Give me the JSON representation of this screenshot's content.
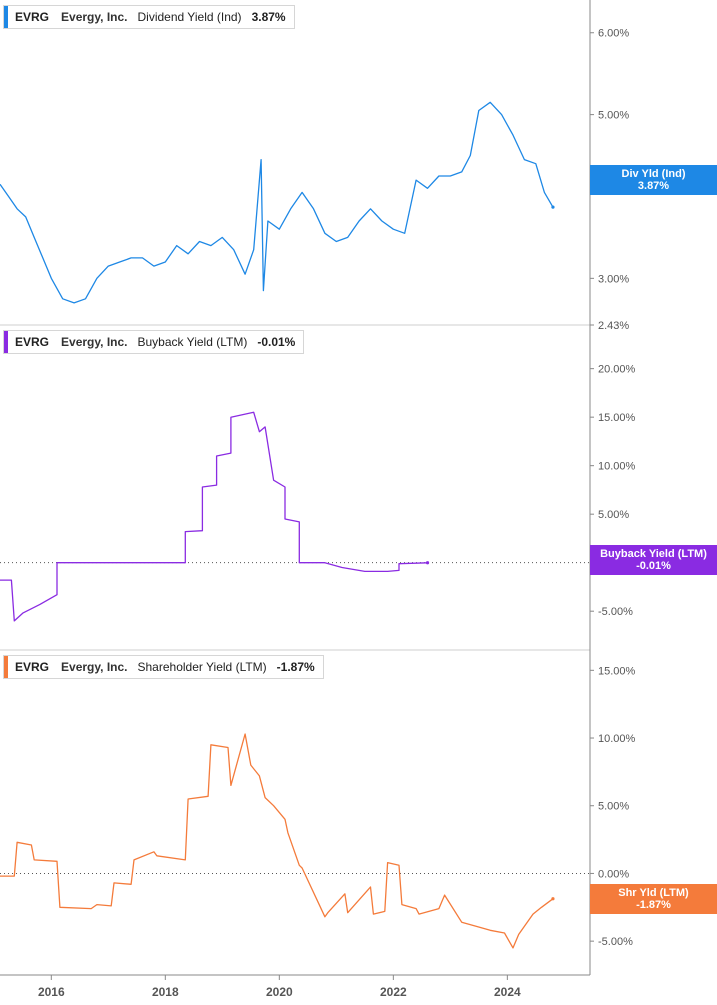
{
  "x_axis": {
    "ticks": [
      "2016",
      "2018",
      "2020",
      "2022",
      "2024"
    ]
  },
  "panels": [
    {
      "ticker": "EVRG",
      "company": "Evergy, Inc.",
      "metric": "Dividend Yield (Ind)",
      "value": "3.87%",
      "color": "#1e88e5",
      "y_ticks": [
        "6.00%",
        "5.00%",
        "3.00%",
        "2.43%"
      ],
      "callout_label": "Div Yld (Ind)",
      "callout_value": "3.87%"
    },
    {
      "ticker": "EVRG",
      "company": "Evergy, Inc.",
      "metric": "Buyback Yield (LTM)",
      "value": "-0.01%",
      "color": "#8a2be2",
      "y_ticks": [
        "20.00%",
        "15.00%",
        "10.00%",
        "5.00%",
        "-5.00%"
      ],
      "callout_label": "Buyback Yield (LTM)",
      "callout_value": "-0.01%"
    },
    {
      "ticker": "EVRG",
      "company": "Evergy, Inc.",
      "metric": "Shareholder Yield (LTM)",
      "value": "-1.87%",
      "color": "#f47b3b",
      "y_ticks": [
        "15.00%",
        "10.00%",
        "5.00%",
        "0.00%",
        "-5.00%"
      ],
      "callout_label": "Shr Yld (LTM)",
      "callout_value": "-1.87%"
    }
  ],
  "chart_data": [
    {
      "type": "line",
      "title": "EVRG Evergy, Inc. Dividend Yield (Ind)",
      "color": "#1e88e5",
      "y_ticks": [
        6.0,
        5.0,
        3.0,
        2.43
      ],
      "ylim": [
        2.43,
        6.4
      ],
      "x": [
        2015.6,
        2015.75,
        2015.9,
        2016.05,
        2016.2,
        2016.35,
        2016.5,
        2016.7,
        2016.9,
        2017.1,
        2017.3,
        2017.5,
        2017.7,
        2017.9,
        2018.1,
        2018.3,
        2018.5,
        2018.7,
        2018.9,
        2019.1,
        2019.3,
        2019.5,
        2019.7,
        2019.9,
        2020.05,
        2020.18,
        2020.22,
        2020.3,
        2020.5,
        2020.7,
        2020.9,
        2021.1,
        2021.3,
        2021.5,
        2021.7,
        2021.9,
        2022.1,
        2022.3,
        2022.5,
        2022.7,
        2022.9,
        2023.1,
        2023.3,
        2023.5,
        2023.7,
        2023.85,
        2024.0,
        2024.2,
        2024.4,
        2024.6,
        2024.8,
        2025.0,
        2025.15,
        2025.3
      ],
      "values": [
        4.15,
        4.0,
        3.85,
        3.75,
        3.5,
        3.25,
        3.0,
        2.75,
        2.7,
        2.75,
        3.0,
        3.15,
        3.2,
        3.25,
        3.25,
        3.15,
        3.2,
        3.4,
        3.3,
        3.45,
        3.4,
        3.5,
        3.35,
        3.05,
        3.35,
        4.45,
        2.85,
        3.7,
        3.6,
        3.85,
        4.05,
        3.85,
        3.55,
        3.45,
        3.5,
        3.7,
        3.85,
        3.7,
        3.6,
        3.55,
        4.2,
        4.1,
        4.25,
        4.25,
        4.3,
        4.5,
        5.05,
        5.15,
        5.0,
        4.75,
        4.45,
        4.4,
        4.05,
        3.87
      ]
    },
    {
      "type": "line",
      "title": "EVRG Evergy, Inc. Buyback Yield (LTM)",
      "color": "#8a2be2",
      "y_ticks": [
        20.0,
        15.0,
        10.0,
        5.0,
        -5.0
      ],
      "ylim": [
        -9,
        24.5
      ],
      "x": [
        2015.6,
        2015.8,
        2015.85,
        2016.0,
        2016.3,
        2016.6,
        2016.6,
        2018.85,
        2018.85,
        2019.15,
        2019.15,
        2019.4,
        2019.4,
        2019.65,
        2019.65,
        2020.05,
        2020.15,
        2020.25,
        2020.4,
        2020.6,
        2020.6,
        2020.85,
        2020.85,
        2021.3,
        2021.6,
        2022.0,
        2022.4,
        2022.6,
        2022.6,
        2023.1
      ],
      "values": [
        -1.8,
        -1.8,
        -6.0,
        -5.2,
        -4.3,
        -3.3,
        0.0,
        0.0,
        3.2,
        3.3,
        7.8,
        8.0,
        11.0,
        11.3,
        15.0,
        15.5,
        13.5,
        14.0,
        8.5,
        7.8,
        4.5,
        4.2,
        0.0,
        0.0,
        -0.5,
        -0.9,
        -0.9,
        -0.8,
        -0.1,
        -0.01
      ]
    },
    {
      "type": "line",
      "title": "EVRG Evergy, Inc. Shareholder Yield (LTM)",
      "color": "#f47b3b",
      "y_ticks": [
        15.0,
        10.0,
        5.0,
        0.0,
        -5.0
      ],
      "ylim": [
        -7.5,
        16.5
      ],
      "x": [
        2015.6,
        2015.85,
        2015.9,
        2016.15,
        2016.2,
        2016.6,
        2016.65,
        2017.2,
        2017.3,
        2017.55,
        2017.6,
        2017.9,
        2017.95,
        2018.3,
        2018.35,
        2018.85,
        2018.9,
        2019.25,
        2019.3,
        2019.6,
        2019.65,
        2019.9,
        2020.0,
        2020.15,
        2020.25,
        2020.4,
        2020.6,
        2020.65,
        2020.85,
        2020.9,
        2021.3,
        2021.35,
        2021.65,
        2021.7,
        2022.1,
        2022.15,
        2022.35,
        2022.4,
        2022.6,
        2022.65,
        2022.9,
        2022.95,
        2023.3,
        2023.4,
        2023.7,
        2023.95,
        2024.2,
        2024.45,
        2024.6,
        2024.7,
        2024.95,
        2025.1,
        2025.3
      ],
      "values": [
        -0.2,
        -0.2,
        2.3,
        2.1,
        1.0,
        0.9,
        -2.5,
        -2.6,
        -2.3,
        -2.4,
        -0.7,
        -0.8,
        1.0,
        1.6,
        1.3,
        1.0,
        5.5,
        5.7,
        9.5,
        9.3,
        6.5,
        10.3,
        8.0,
        7.2,
        5.6,
        5.0,
        4.0,
        3.0,
        0.6,
        0.4,
        -3.2,
        -2.9,
        -1.5,
        -2.9,
        -1.0,
        -3.0,
        -2.8,
        0.8,
        0.6,
        -2.3,
        -2.6,
        -3.0,
        -2.6,
        -1.6,
        -3.6,
        -3.9,
        -4.2,
        -4.4,
        -5.5,
        -4.5,
        -3.0,
        -2.5,
        -1.87
      ]
    }
  ]
}
